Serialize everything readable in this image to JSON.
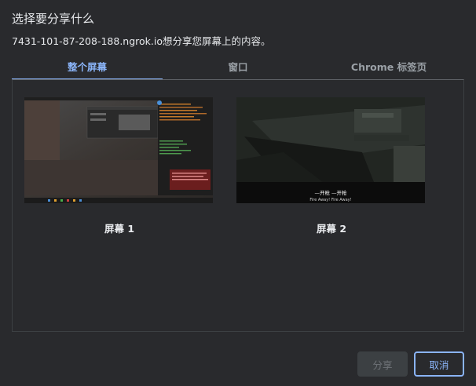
{
  "dialog": {
    "title": "选择要分享什么",
    "subtitle": "7431-101-87-208-188.ngrok.io想分享您屏幕上的内容。"
  },
  "tabs": [
    {
      "label": "整个屏幕",
      "active": true
    },
    {
      "label": "窗口",
      "active": false
    },
    {
      "label": "Chrome 标签页",
      "active": false
    }
  ],
  "sources": [
    {
      "label": "屏幕 1"
    },
    {
      "label": "屏幕 2",
      "subtitle_line1": "—开枪 —开枪",
      "subtitle_line2": "Fire Away! Fire Away!"
    }
  ],
  "buttons": {
    "share": "分享",
    "cancel": "取消"
  },
  "colors": {
    "background": "#292a2d",
    "accent": "#8ab4f8",
    "border": "#3c4043"
  }
}
